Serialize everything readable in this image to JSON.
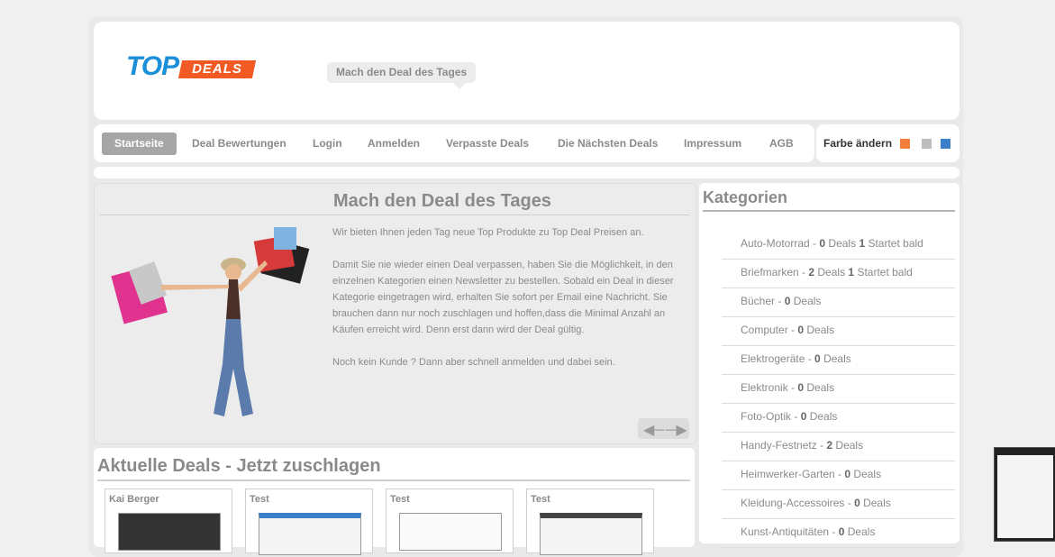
{
  "brand": {
    "logo_top": "TOP",
    "logo_deals": "DEALS",
    "orange": "#f15a22",
    "blue": "#1b8fd8"
  },
  "header": {
    "tagline": "Mach den Deal des Tages"
  },
  "nav": {
    "items": [
      "Startseite",
      "Deal Bewertungen",
      "Login",
      "Anmelden",
      "Verpasste Deals",
      "Die Nächsten Deals",
      "Impressum",
      "AGB"
    ]
  },
  "color_picker": {
    "label": "Farbe ändern",
    "swatches": [
      "#f57f3a",
      "#bdbdbd",
      "#3a7fc9"
    ]
  },
  "hero": {
    "title": "Mach den Deal des Tages",
    "paragraphs": [
      "Wir bieten Ihnen jeden Tag neue Top Produkte zu Top Deal Preisen an.",
      "Damit Sie nie wieder einen Deal verpassen, haben Sie die Möglichkeit, in den einzelnen Kategorien einen Newsletter zu bestellen. Sobald ein Deal in dieser Kategorie eingetragen wird, erhalten Sie sofort per Email eine Nachricht. Sie brauchen dann nur noch zuschlagen und hoffen,dass die Minimal Anzahl an Käufen erreicht wird. Denn erst dann wird der Deal gültig.",
      "Noch kein Kunde ? Dann aber schnell anmelden und dabei sein."
    ],
    "prev_icon": "arrow-left-icon",
    "next_icon": "arrow-right-icon"
  },
  "sidebar": {
    "title": "Kategorien",
    "categories": [
      {
        "name": "Auto-Motorrad",
        "count": "0",
        "extra_count": "1",
        "extra": "Startet bald"
      },
      {
        "name": "Briefmarken",
        "count": "2",
        "extra_count": "1",
        "extra": "Startet bald"
      },
      {
        "name": "Bücher",
        "count": "0"
      },
      {
        "name": "Computer",
        "count": "0"
      },
      {
        "name": "Elektrogeräte",
        "count": "0"
      },
      {
        "name": "Elektronik",
        "count": "0"
      },
      {
        "name": "Foto-Optik",
        "count": "0"
      },
      {
        "name": "Handy-Festnetz",
        "count": "2"
      },
      {
        "name": "Heimwerker-Garten",
        "count": "0"
      },
      {
        "name": "Kleidung-Accessoires",
        "count": "0"
      },
      {
        "name": "Kunst-Antiquitäten",
        "count": "0"
      }
    ],
    "deals_word": "Deals"
  },
  "deals": {
    "title": "Aktuelle Deals - Jetzt zuschlagen",
    "cards": [
      "Kai Berger",
      "Test",
      "Test",
      "Test"
    ]
  }
}
